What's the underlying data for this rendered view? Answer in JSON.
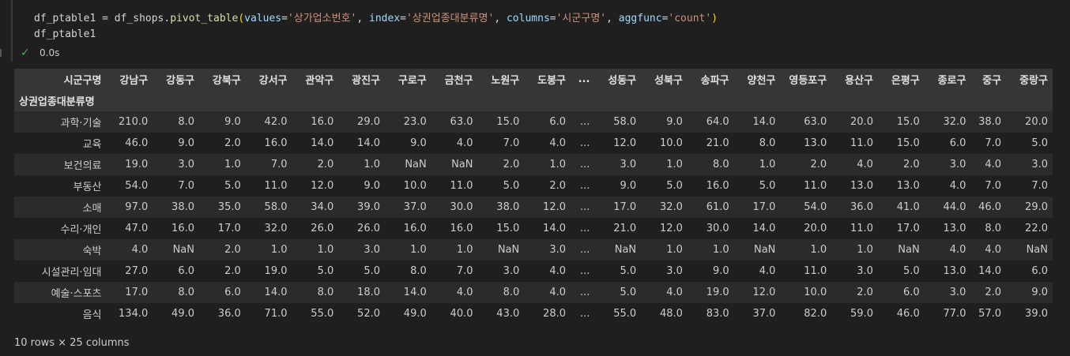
{
  "code": {
    "line1": {
      "var": "df_ptable1",
      "eq": " = ",
      "obj": "df_shops.",
      "fn": "pivot_table",
      "open": "(",
      "k1": "values",
      "v1": "'상가업소번호'",
      "k2": "index",
      "v2": "'상권업종대분류명'",
      "k3": "columns",
      "v3": "'시군구명'",
      "k4": "aggfunc",
      "v4": "'count'",
      "close": ")"
    },
    "line2": "df_ptable1"
  },
  "status": {
    "time": "0.0s"
  },
  "table": {
    "columns_name": "시군구명",
    "index_name": "상권업종대분류명",
    "columns": [
      "강남구",
      "강동구",
      "강북구",
      "강서구",
      "관악구",
      "광진구",
      "구로구",
      "금천구",
      "노원구",
      "도봉구",
      "...",
      "성동구",
      "성북구",
      "송파구",
      "양천구",
      "영등포구",
      "용산구",
      "은평구",
      "종로구",
      "중구",
      "중랑구"
    ],
    "rows": [
      {
        "label": "과학·기술",
        "values": [
          "210.0",
          "8.0",
          "9.0",
          "42.0",
          "16.0",
          "29.0",
          "23.0",
          "63.0",
          "15.0",
          "6.0",
          "...",
          "58.0",
          "9.0",
          "64.0",
          "14.0",
          "63.0",
          "20.0",
          "15.0",
          "32.0",
          "38.0",
          "20.0"
        ]
      },
      {
        "label": "교육",
        "values": [
          "46.0",
          "9.0",
          "2.0",
          "16.0",
          "14.0",
          "14.0",
          "9.0",
          "4.0",
          "7.0",
          "4.0",
          "...",
          "12.0",
          "10.0",
          "21.0",
          "8.0",
          "13.0",
          "11.0",
          "15.0",
          "6.0",
          "7.0",
          "5.0"
        ]
      },
      {
        "label": "보건의료",
        "values": [
          "19.0",
          "3.0",
          "1.0",
          "7.0",
          "2.0",
          "1.0",
          "NaN",
          "NaN",
          "2.0",
          "1.0",
          "...",
          "3.0",
          "1.0",
          "8.0",
          "1.0",
          "2.0",
          "4.0",
          "2.0",
          "3.0",
          "4.0",
          "3.0"
        ]
      },
      {
        "label": "부동산",
        "values": [
          "54.0",
          "7.0",
          "5.0",
          "11.0",
          "12.0",
          "9.0",
          "10.0",
          "11.0",
          "5.0",
          "2.0",
          "...",
          "9.0",
          "5.0",
          "16.0",
          "5.0",
          "11.0",
          "13.0",
          "13.0",
          "4.0",
          "7.0",
          "7.0"
        ]
      },
      {
        "label": "소매",
        "values": [
          "97.0",
          "38.0",
          "35.0",
          "58.0",
          "34.0",
          "39.0",
          "37.0",
          "30.0",
          "38.0",
          "12.0",
          "...",
          "17.0",
          "32.0",
          "61.0",
          "17.0",
          "54.0",
          "36.0",
          "41.0",
          "44.0",
          "46.0",
          "29.0"
        ]
      },
      {
        "label": "수리·개인",
        "values": [
          "47.0",
          "16.0",
          "17.0",
          "32.0",
          "26.0",
          "26.0",
          "16.0",
          "16.0",
          "15.0",
          "14.0",
          "...",
          "21.0",
          "12.0",
          "30.0",
          "14.0",
          "20.0",
          "11.0",
          "17.0",
          "13.0",
          "8.0",
          "22.0"
        ]
      },
      {
        "label": "숙박",
        "values": [
          "4.0",
          "NaN",
          "2.0",
          "1.0",
          "1.0",
          "3.0",
          "1.0",
          "1.0",
          "NaN",
          "3.0",
          "...",
          "NaN",
          "1.0",
          "1.0",
          "NaN",
          "1.0",
          "1.0",
          "NaN",
          "4.0",
          "4.0",
          "NaN"
        ]
      },
      {
        "label": "시설관리·임대",
        "values": [
          "27.0",
          "6.0",
          "2.0",
          "19.0",
          "5.0",
          "5.0",
          "8.0",
          "7.0",
          "3.0",
          "4.0",
          "...",
          "5.0",
          "3.0",
          "9.0",
          "4.0",
          "11.0",
          "3.0",
          "5.0",
          "13.0",
          "14.0",
          "6.0"
        ]
      },
      {
        "label": "예술·스포츠",
        "values": [
          "17.0",
          "8.0",
          "6.0",
          "14.0",
          "8.0",
          "18.0",
          "14.0",
          "4.0",
          "8.0",
          "4.0",
          "...",
          "5.0",
          "4.0",
          "19.0",
          "12.0",
          "10.0",
          "2.0",
          "6.0",
          "3.0",
          "2.0",
          "9.0"
        ]
      },
      {
        "label": "음식",
        "values": [
          "134.0",
          "49.0",
          "36.0",
          "71.0",
          "55.0",
          "52.0",
          "49.0",
          "40.0",
          "43.0",
          "28.0",
          "...",
          "55.0",
          "48.0",
          "83.0",
          "37.0",
          "82.0",
          "59.0",
          "46.0",
          "77.0",
          "57.0",
          "39.0"
        ]
      }
    ],
    "footer": "10 rows × 25 columns"
  },
  "icons": {
    "status": "check-icon"
  },
  "colors": {
    "background": "#1f1f1f",
    "header_bg": "#363636",
    "row_stripe": "#2b2b2b",
    "success": "#4caf50"
  }
}
